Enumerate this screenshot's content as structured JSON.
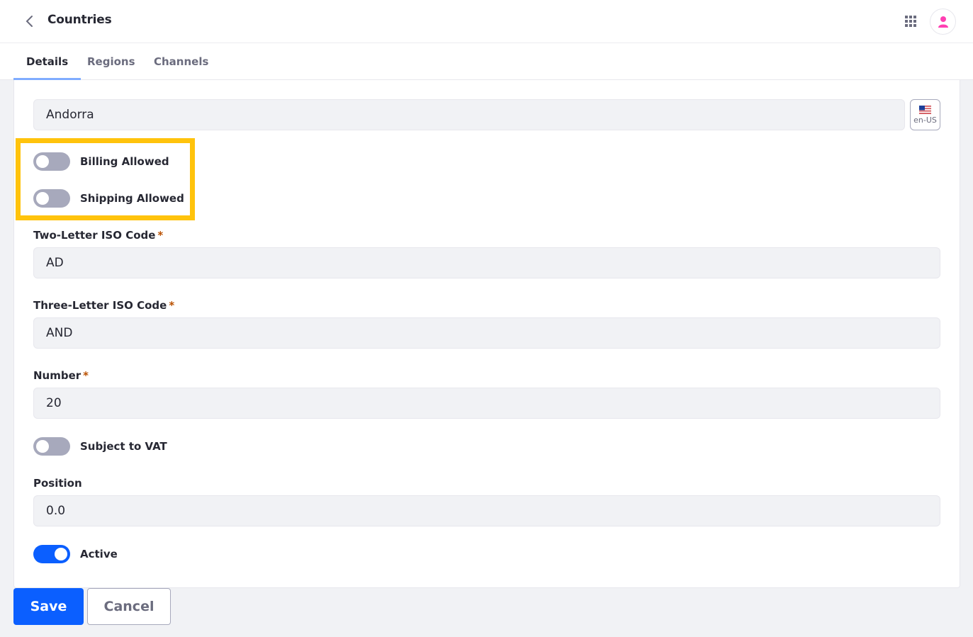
{
  "header": {
    "title": "Countries",
    "back_icon": "chevron-left-icon",
    "apps_icon": "apps-grid-icon",
    "avatar_icon": "user-icon"
  },
  "tabs": [
    {
      "label": "Details",
      "active": true
    },
    {
      "label": "Regions",
      "active": false
    },
    {
      "label": "Channels",
      "active": false
    }
  ],
  "form": {
    "name": {
      "value": "Andorra"
    },
    "language": {
      "label": "en-US",
      "icon": "us-flag-icon"
    },
    "billing_allowed": {
      "label": "Billing Allowed",
      "checked": false
    },
    "shipping_allowed": {
      "label": "Shipping Allowed",
      "checked": false
    },
    "two_letter_iso": {
      "label": "Two-Letter ISO Code",
      "required_mark": "*",
      "value": "AD"
    },
    "three_letter_iso": {
      "label": "Three-Letter ISO Code",
      "required_mark": "*",
      "value": "AND"
    },
    "number": {
      "label": "Number",
      "required_mark": "*",
      "value": "20"
    },
    "subject_to_vat": {
      "label": "Subject to VAT",
      "checked": false
    },
    "position": {
      "label": "Position",
      "value": "0.0"
    },
    "active": {
      "label": "Active",
      "checked": true
    }
  },
  "actions": {
    "save_label": "Save",
    "cancel_label": "Cancel"
  },
  "colors": {
    "primary": "#0b5fff",
    "highlight": "#ffc30c",
    "avatar": "#ff3fb2",
    "tab_indicator": "#80acff"
  }
}
